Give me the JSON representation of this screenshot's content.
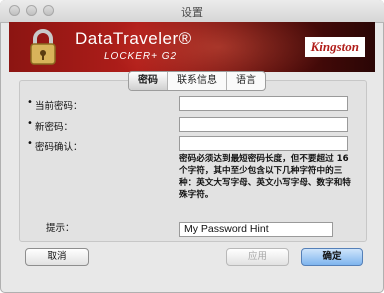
{
  "window": {
    "title": "设置"
  },
  "banner": {
    "product_line1": "DataTraveler®",
    "product_line2": "LOCKER+ G2",
    "brand": "Kingston",
    "colors": {
      "banner_red": "#b11e1a",
      "banner_dark": "#2a0605"
    }
  },
  "tabs": [
    {
      "label": "密码",
      "active": true
    },
    {
      "label": "联系信息",
      "active": false
    },
    {
      "label": "语言",
      "active": false
    }
  ],
  "form": {
    "current_password_label": "当前密码：",
    "new_password_label": "新密码：",
    "confirm_password_label": "密码确认：",
    "bullet": "•",
    "help_text": "密码必须达到最短密码长度，但不要超过 16 个字符，其中至少包含以下几种字符中的三种：英文大写字母、英文小写字母、数字和特殊字符。",
    "hint_label": "提示：",
    "hint_value": "My Password Hint"
  },
  "buttons": {
    "cancel": "取消",
    "apply": "应用",
    "ok": "确定"
  }
}
